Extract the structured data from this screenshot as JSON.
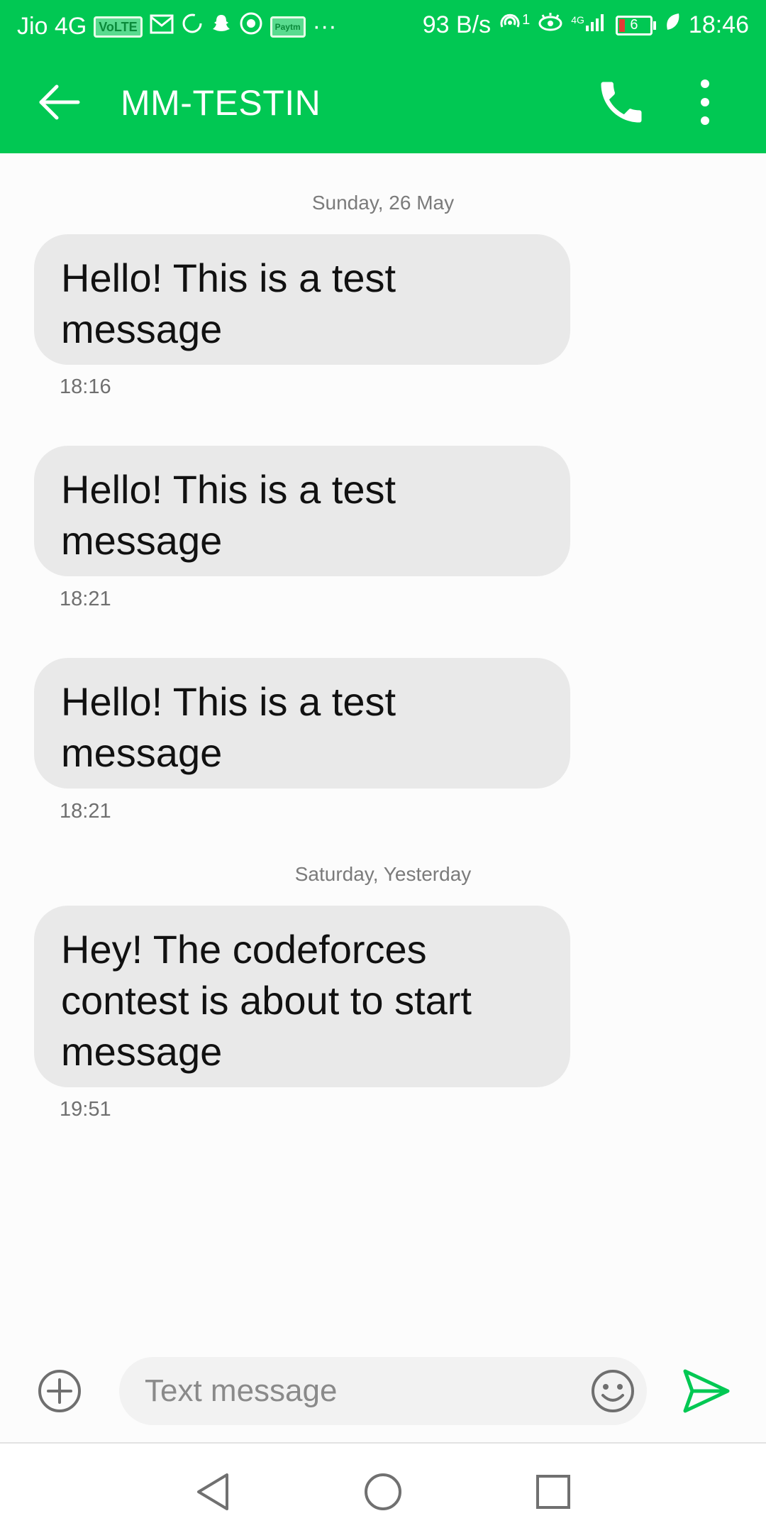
{
  "status_bar": {
    "carrier": "Jio 4G",
    "volte_badge": "VoLTE",
    "net_speed": "93 B/s",
    "hotspot_count": "1",
    "network_type": "4G",
    "battery_level": "6",
    "clock": "18:46",
    "paytm_badge": "Paytm",
    "more_indicator": "···"
  },
  "app_bar": {
    "title": "MM-TESTIN",
    "accent_color": "#01c853"
  },
  "conversation": {
    "date_1": "Sunday, 26 May",
    "date_2": "Saturday, Yesterday",
    "messages": [
      {
        "text": "Hello! This is a test message",
        "time": "18:16"
      },
      {
        "text": "Hello! This is a test message",
        "time": "18:21"
      },
      {
        "text": "Hello! This is a test message",
        "time": "18:21"
      },
      {
        "text": "Hey! The codeforces contest is about to start message",
        "time": "19:51"
      }
    ]
  },
  "compose": {
    "placeholder": "Text message",
    "value": ""
  },
  "icons": {
    "back": "arrow-left-icon",
    "call": "phone-icon",
    "menu": "more-vertical-icon",
    "add": "plus-circle-icon",
    "emoji": "smiley-icon",
    "send": "send-icon",
    "nav_back": "triangle-back-icon",
    "nav_home": "circle-home-icon",
    "nav_recents": "square-recents-icon"
  }
}
